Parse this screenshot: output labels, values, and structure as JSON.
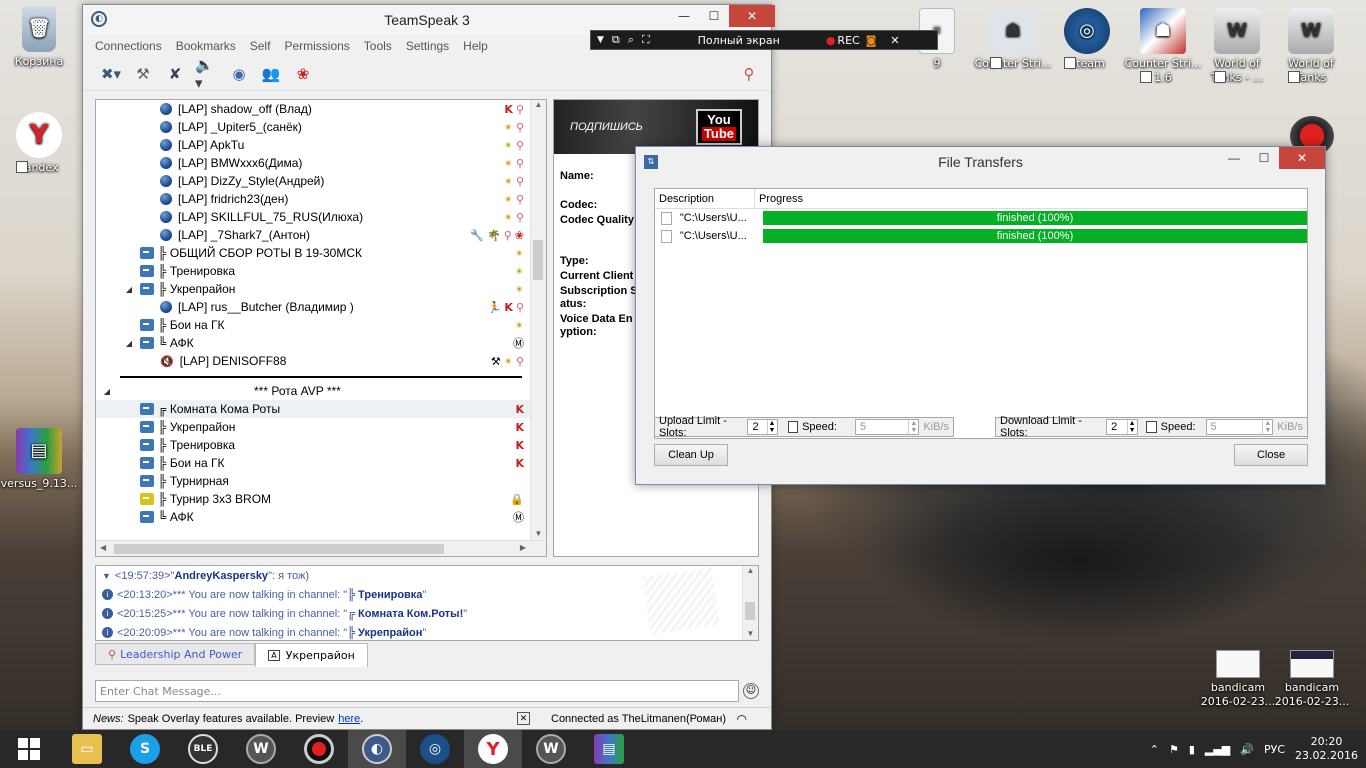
{
  "desktop": {
    "icons_left": [
      {
        "label": "Корзина",
        "icon": "recycle-bin-icon",
        "color": "#9fb6cc"
      },
      {
        "label": "Yandex",
        "icon": "yandex-browser-icon",
        "color": "#ffffff"
      },
      {
        "label": "versus_9.13...",
        "icon": "winrar-archive-icon",
        "color": "#7e3a9c"
      }
    ],
    "icons_top": [
      {
        "label": "9",
        "icon": "text-file-icon",
        "color": "#f4f4f4"
      },
      {
        "label": "Counter Stri...",
        "icon": "counter-strike-icon",
        "color": "#d0d8e0"
      },
      {
        "label": "Steam",
        "icon": "steam-icon",
        "color": "#1b4f8a"
      },
      {
        "label": "Counter Stri... 1.6",
        "icon": "counter-strike-16-icon",
        "color": "#2760b4"
      },
      {
        "label": "World of Tanks - ...",
        "icon": "world-of-tanks-icon",
        "color": "#c8c8c8"
      },
      {
        "label": "World of Tanks",
        "icon": "world-of-tanks-icon",
        "color": "#c8c8c8"
      }
    ],
    "icons_bottom": [
      {
        "label": "bandicam 2016-02-23...",
        "icon": "image-thumbnail-icon"
      },
      {
        "label": "bandicam 2016-02-23...",
        "icon": "image-thumbnail-icon"
      }
    ]
  },
  "bandicam": {
    "label": "Полный экран",
    "rec": "REC"
  },
  "teamspeak": {
    "title": "TeamSpeak 3",
    "menu": [
      "Connections",
      "Bookmarks",
      "Self",
      "Permissions",
      "Tools",
      "Settings",
      "Help"
    ],
    "tree": [
      {
        "type": "user",
        "level": 2,
        "name": "[LAP] shadow_off (Влад)",
        "badges": [
          "K",
          "mic"
        ]
      },
      {
        "type": "user",
        "level": 2,
        "name": "[LAP] _Upiter5_(санёк)",
        "badges": [
          "star",
          "mic"
        ]
      },
      {
        "type": "user",
        "level": 2,
        "name": "[LAP] ApkTu",
        "badges": [
          "star",
          "mic"
        ]
      },
      {
        "type": "user",
        "level": 2,
        "name": "[LAP] BMWxxx6(Дима)",
        "badges": [
          "star",
          "mic"
        ]
      },
      {
        "type": "user",
        "level": 2,
        "name": "[LAP] DizZy_Style(Андрей)",
        "badges": [
          "star",
          "mic"
        ]
      },
      {
        "type": "user",
        "level": 2,
        "name": "[LAP] fridrich23(ден)",
        "badges": [
          "star",
          "mic"
        ]
      },
      {
        "type": "user",
        "level": 2,
        "name": "[LAP] SKILLFUL_75_RUS(Илюха)",
        "badges": [
          "star",
          "mic"
        ]
      },
      {
        "type": "user",
        "level": 2,
        "name": "[LAP] _7Shark7_(Антон)",
        "badges": [
          "tool",
          "palm",
          "mic",
          "rose"
        ]
      },
      {
        "type": "channel",
        "level": 1,
        "name": "╠ ОБЩИЙ СБОР РОТЫ В 19-30МСК",
        "badges": [
          "star"
        ]
      },
      {
        "type": "channel",
        "level": 1,
        "name": "╠ Тренировка",
        "badges": [
          "star"
        ]
      },
      {
        "type": "channel",
        "level": 1,
        "expand": true,
        "name": "╠ Укрепрайон",
        "badges": [
          "star"
        ]
      },
      {
        "type": "user",
        "level": 2,
        "name": "[LAP] rus__Butcher (Владимир )",
        "badges": [
          "runner",
          "K",
          "mic"
        ]
      },
      {
        "type": "channel",
        "level": 1,
        "name": "╠ Бои на ГК",
        "badges": [
          "star"
        ]
      },
      {
        "type": "channel",
        "level": 1,
        "expand": true,
        "name": "╚ АФК",
        "badges": [
          "M"
        ]
      },
      {
        "type": "user",
        "level": 2,
        "away": true,
        "name": "[LAP] DENISOFF88",
        "badges": [
          "away",
          "star",
          "mic"
        ]
      }
    ],
    "spacer_title": "*** Рота AVP ***",
    "tree2": [
      {
        "type": "channel",
        "level": 1,
        "name": "╔ Комната Кома Роты",
        "badges": [
          "K"
        ],
        "selected": true
      },
      {
        "type": "channel",
        "level": 1,
        "name": "╠ Укрепрайон",
        "badges": [
          "K"
        ]
      },
      {
        "type": "channel",
        "level": 1,
        "name": "╠ Тренировка",
        "badges": [
          "K"
        ]
      },
      {
        "type": "channel",
        "level": 1,
        "name": "╠ Бои на ГК",
        "badges": [
          "K"
        ]
      },
      {
        "type": "channel",
        "level": 1,
        "name": "╠ Турнирная",
        "badges": []
      },
      {
        "type": "channel",
        "level": 1,
        "yellow": true,
        "name": "╠ Турнир 3x3 BROM",
        "badges": [
          "lock"
        ]
      },
      {
        "type": "channel",
        "level": 1,
        "name": "╚ АФК",
        "badges": [
          "M"
        ]
      }
    ],
    "info": {
      "banner_text": "ПОДПИШИСЬ",
      "banner_logo_top": "You",
      "banner_logo_bottom": "Tube",
      "name_label": "Name:",
      "codec_label": "Codec:",
      "codec_quality_label": "Codec Quality",
      "type_label": "Type:",
      "current_client_label": "Current Client",
      "subscription_label": "Subscription S",
      "subscription_label2": "atus:",
      "voice_label": "Voice Data En",
      "voice_label2": "yption:"
    },
    "chat": [
      {
        "time": "<19:57:39>",
        "text": " \"",
        "bold": "AndreyKaspersky",
        "tail": "\": я тож)",
        "icon": "arrow"
      },
      {
        "time": "<20:13:20>",
        "text": " *** You are now talking in channel: \"",
        "bold": "╠ Тренировка",
        "tail": "\"",
        "icon": "info"
      },
      {
        "time": "<20:15:25>",
        "text": " *** You are now talking in channel: \"",
        "bold": "╔ Комната Ком.Роты!",
        "tail": "\"",
        "icon": "info"
      },
      {
        "time": "<20:20:09>",
        "text": " *** You are now talking in channel: \"",
        "bold": "╠ Укрепрайон",
        "tail": "\"",
        "icon": "info"
      }
    ],
    "tabs": [
      "Leadership And Power",
      "Укрепрайон"
    ],
    "chat_placeholder": "Enter Chat Message...",
    "news_label": "News:",
    "news_text": "Speak Overlay features available. Preview",
    "news_link": "here",
    "news_dot": ".",
    "connected": "Connected as TheLitmanen(Роман)"
  },
  "file_transfers": {
    "title": "File Transfers",
    "col_description": "Description",
    "col_progress": "Progress",
    "rows": [
      {
        "desc": "\"C:\\Users\\U...",
        "progress": "finished (100%)",
        "pct": 100
      },
      {
        "desc": "\"C:\\Users\\U...",
        "progress": "finished (100%)",
        "pct": 100
      }
    ],
    "upload_label": "Upload Limit - Slots:",
    "upload_slots": "2",
    "download_label": "Download Limit - Slots:",
    "download_slots": "2",
    "speed_label": "Speed:",
    "speed_value": "5",
    "speed_unit": "KiB/s",
    "cleanup": "Clean Up",
    "close": "Close"
  },
  "tray": {
    "lang": "РУС",
    "time": "20:20",
    "date": "23.02.2016"
  }
}
